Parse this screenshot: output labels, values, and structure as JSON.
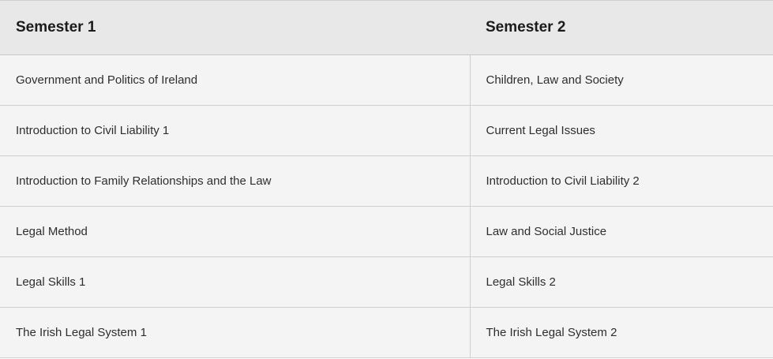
{
  "table": {
    "headers": [
      "Semester 1",
      "Semester 2"
    ],
    "rows": [
      [
        "Government and Politics of Ireland",
        "Children, Law and Society"
      ],
      [
        "Introduction to Civil Liability 1",
        "Current Legal Issues"
      ],
      [
        "Introduction to Family Relationships and the Law",
        "Introduction to Civil Liability 2"
      ],
      [
        "Legal Method",
        "Law and Social Justice"
      ],
      [
        "Legal Skills 1",
        "Legal Skills 2"
      ],
      [
        "The Irish Legal System 1",
        "The Irish Legal System 2"
      ]
    ]
  }
}
